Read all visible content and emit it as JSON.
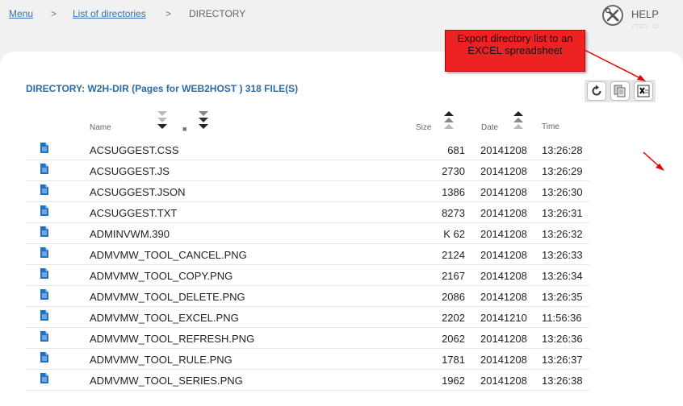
{
  "breadcrumb": {
    "menu": "Menu",
    "sep1": ">",
    "list": "List of directories",
    "sep2": ">",
    "current": "DIRECTORY"
  },
  "help": {
    "label": "HELP"
  },
  "directory": {
    "title": "DIRECTORY: W2H-DIR (Pages for WEB2HOST ) 318 FILE(S)"
  },
  "toolbar": {
    "icons": [
      "refresh-icon",
      "copy-icon",
      "excel-icon"
    ]
  },
  "callout": {
    "text": "Export directory list to an EXCEL spreadsheet"
  },
  "colors": {
    "title_blue": "#2d6ba6",
    "callout_red": "#e22",
    "arrow_red": "#e00000",
    "file_icon": "#1f6fc4"
  },
  "table": {
    "headers": {
      "name": "Name",
      "size": "Size",
      "date": "Date",
      "time": "Time"
    },
    "rows": [
      {
        "name": "ACSUGGEST.CSS",
        "size": "681",
        "date": "20141208",
        "time": "13:26:28"
      },
      {
        "name": "ACSUGGEST.JS",
        "size": "2730",
        "date": "20141208",
        "time": "13:26:29"
      },
      {
        "name": "ACSUGGEST.JSON",
        "size": "1386",
        "date": "20141208",
        "time": "13:26:30"
      },
      {
        "name": "ACSUGGEST.TXT",
        "size": "8273",
        "date": "20141208",
        "time": "13:26:31"
      },
      {
        "name": "ADMINVWM.390",
        "size": "K 62",
        "date": "20141208",
        "time": "13:26:32"
      },
      {
        "name": "ADMVMW_TOOL_CANCEL.PNG",
        "size": "2124",
        "date": "20141208",
        "time": "13:26:33"
      },
      {
        "name": "ADMVMW_TOOL_COPY.PNG",
        "size": "2167",
        "date": "20141208",
        "time": "13:26:34"
      },
      {
        "name": "ADMVMW_TOOL_DELETE.PNG",
        "size": "2086",
        "date": "20141208",
        "time": "13:26:35"
      },
      {
        "name": "ADMVMW_TOOL_EXCEL.PNG",
        "size": "2202",
        "date": "20141210",
        "time": "11:56:36"
      },
      {
        "name": "ADMVMW_TOOL_REFRESH.PNG",
        "size": "2062",
        "date": "20141208",
        "time": "13:26:36"
      },
      {
        "name": "ADMVMW_TOOL_RULE.PNG",
        "size": "1781",
        "date": "20141208",
        "time": "13:26:37"
      },
      {
        "name": "ADMVMW_TOOL_SERIES.PNG",
        "size": "1962",
        "date": "20141208",
        "time": "13:26:38"
      }
    ]
  }
}
